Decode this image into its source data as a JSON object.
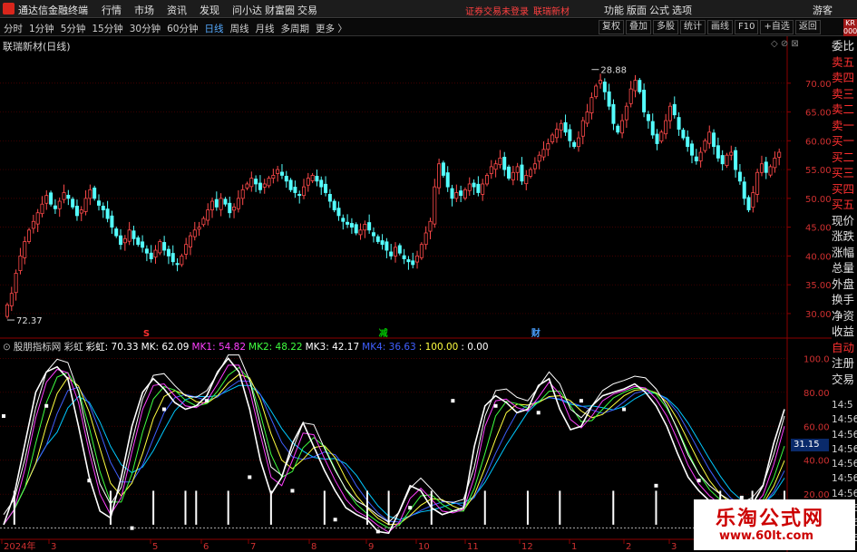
{
  "app": {
    "title": "通达信金融终端",
    "login_status": "证券交易未登录",
    "stock_tag": "联瑞新材",
    "guest": "游客"
  },
  "main_menu": [
    "行情",
    "市场",
    "资讯",
    "发现",
    "问小达",
    "财富圈",
    "交易"
  ],
  "right_menu": [
    "功能",
    "版面",
    "公式",
    "选项"
  ],
  "periods": [
    {
      "label": "分时",
      "active": false
    },
    {
      "label": "1分钟",
      "active": false
    },
    {
      "label": "5分钟",
      "active": false
    },
    {
      "label": "15分钟",
      "active": false
    },
    {
      "label": "30分钟",
      "active": false
    },
    {
      "label": "60分钟",
      "active": false
    },
    {
      "label": "日线",
      "active": true
    },
    {
      "label": "周线",
      "active": false
    },
    {
      "label": "月线",
      "active": false
    },
    {
      "label": "多周期",
      "active": false
    },
    {
      "label": "更多 〉",
      "active": false
    }
  ],
  "toolbar_buttons": [
    "复权",
    "叠加",
    "多股",
    "统计",
    "画线",
    "F10",
    "+自选",
    "返回"
  ],
  "side_tag": "KR\n000",
  "side_panel": [
    {
      "label": "委比",
      "red": false
    },
    {
      "label": "卖五",
      "red": true
    },
    {
      "label": "卖四",
      "red": true
    },
    {
      "label": "卖三",
      "red": true
    },
    {
      "label": "卖二",
      "red": true
    },
    {
      "label": "卖一",
      "red": true
    },
    {
      "label": "买一",
      "red": true
    },
    {
      "label": "买二",
      "red": true
    },
    {
      "label": "买三",
      "red": true
    },
    {
      "label": "买四",
      "red": true
    },
    {
      "label": "买五",
      "red": true
    },
    {
      "label": "现价",
      "red": false
    },
    {
      "label": "涨跌",
      "red": false
    },
    {
      "label": "涨幅",
      "red": false
    },
    {
      "label": "总量",
      "red": false
    },
    {
      "label": "外盘",
      "red": false
    },
    {
      "label": "换手",
      "red": false
    },
    {
      "label": "净资",
      "red": false
    },
    {
      "label": "收益",
      "red": false
    },
    {
      "label": "自动",
      "red": true
    },
    {
      "label": "注册",
      "red": false
    },
    {
      "label": "交易",
      "red": false
    }
  ],
  "side_times": [
    "14:5",
    "14:56",
    "14:56",
    "14:56",
    "14:56",
    "14:56",
    "14:56",
    "14:56",
    "14:56",
    "14:56"
  ],
  "watermark": {
    "text": "乐淘公式网",
    "url": "www.60lt.com"
  },
  "chart_data": [
    {
      "type": "candlestick",
      "title": "联瑞新材(日线)",
      "ylim": [
        27,
        75
      ],
      "yticks": [
        "70.00",
        "65.00",
        "60.00",
        "55.00",
        "50.00",
        "45.00",
        "40.00",
        "35.00",
        "30.00"
      ],
      "ytick_values": [
        70,
        65,
        60,
        55,
        50,
        45,
        40,
        35,
        30
      ],
      "annotations": [
        {
          "text": "72.37",
          "value": 72.37
        },
        {
          "text": "28.88",
          "value": 28.88
        }
      ],
      "event_markers": [
        {
          "text": "S",
          "index": 32,
          "color": "#ff3030"
        },
        {
          "text": "减",
          "index": 86,
          "color": "#00c000"
        },
        {
          "text": "财",
          "index": 121,
          "color": "#4aa0ff"
        }
      ],
      "closes": [
        31.5,
        33.5,
        37,
        40,
        42.5,
        44.5,
        46,
        47.5,
        49,
        50.5,
        49,
        48.2,
        49.5,
        51,
        50,
        48.5,
        47,
        48,
        50,
        51.5,
        50,
        48.8,
        48,
        46.5,
        45,
        43.5,
        42,
        43,
        44.5,
        43,
        42,
        41.5,
        40.5,
        39.5,
        41,
        42.5,
        41,
        40,
        39,
        38.5,
        40,
        42,
        43.5,
        44.5,
        45,
        46.5,
        48,
        49.5,
        48.5,
        50,
        49,
        47.5,
        48.5,
        50,
        51.5,
        52.5,
        53.5,
        52.5,
        51.5,
        52.5,
        53.5,
        54,
        55,
        54,
        53,
        51.5,
        51,
        50.5,
        52,
        53.5,
        54,
        53,
        52,
        51,
        49.5,
        48,
        47,
        46,
        45.5,
        45,
        44,
        44.5,
        45.5,
        44.5,
        43.5,
        42.5,
        42,
        41,
        40,
        41.5,
        40.5,
        39.5,
        39,
        38.5,
        40,
        42,
        44,
        46,
        52,
        56,
        54,
        52,
        50,
        51,
        50.5,
        51.5,
        52.5,
        52,
        51,
        52.5,
        54,
        55.5,
        56,
        57,
        55,
        53.5,
        54.5,
        55.5,
        53,
        54,
        55,
        56,
        57.5,
        58.5,
        59.5,
        61,
        62,
        63,
        61.5,
        60,
        59,
        60.5,
        63.5,
        65,
        67.5,
        69.5,
        70.5,
        68.5,
        66,
        63,
        61.5,
        63.5,
        66,
        69,
        70.5,
        68.5,
        65,
        63.5,
        61,
        59.5,
        61.5,
        63.5,
        66,
        64.5,
        62,
        60.5,
        59,
        57.5,
        56.5,
        58,
        60,
        61.5,
        59,
        57,
        56,
        57.5,
        58,
        55,
        53,
        50,
        48,
        51,
        54.5,
        56,
        54.5,
        55.5,
        57,
        58
      ],
      "extremes": [
        {
          "index": 0,
          "value": 28.88
        },
        {
          "index": 134,
          "value": 72.37
        }
      ]
    },
    {
      "type": "line",
      "title": "股朋指标网 彩虹",
      "legend": [
        {
          "label": "彩虹: 70.33",
          "color": "#ffffff"
        },
        {
          "label": "MK: 62.09",
          "color": "#ffffff"
        },
        {
          "label": "MK1: 54.82",
          "color": "#ff40ff"
        },
        {
          "label": "MK2: 48.22",
          "color": "#40ff40"
        },
        {
          "label": "MK3: 42.17",
          "color": "#ffffff"
        },
        {
          "label": "MK4: 36.63",
          "color": "#4060ff"
        },
        {
          "label": ": 100.00",
          "color": "#ffff40"
        },
        {
          "label": ": 0.00",
          "color": "#ffffff"
        }
      ],
      "ylim": [
        -5,
        105
      ],
      "yticks": [
        "100.0",
        "80.00",
        "60.00",
        "40.00",
        "20.00"
      ],
      "ytick_values": [
        100,
        80,
        60,
        40,
        20
      ],
      "current_value_label": "31.15",
      "series_colors": [
        "#ffffff",
        "#ff40ff",
        "#40ff40",
        "#ffff40",
        "#4060ff",
        "#00c8ff"
      ],
      "main": [
        2,
        20,
        50,
        80,
        92,
        95,
        88,
        60,
        30,
        10,
        6,
        30,
        60,
        80,
        88,
        82,
        74,
        70,
        72,
        78,
        92,
        100,
        92,
        70,
        40,
        20,
        30,
        50,
        62,
        48,
        34,
        22,
        12,
        8,
        5,
        -2,
        -3,
        10,
        25,
        22,
        12,
        8,
        10,
        12,
        48,
        72,
        78,
        74,
        68,
        70,
        84,
        88,
        70,
        58,
        60,
        72,
        78,
        80,
        82,
        85,
        80,
        72,
        60,
        44,
        30,
        22,
        16,
        12,
        8,
        10,
        14,
        25,
        50,
        70
      ],
      "markers": [
        66,
        72,
        28,
        0,
        70,
        75,
        30,
        22,
        5,
        -2,
        12,
        75,
        72,
        68,
        75,
        70,
        25,
        28,
        18,
        12
      ],
      "white_bar_indices": [
        1,
        10,
        14,
        17,
        19,
        22,
        26,
        31,
        35,
        37,
        41,
        46,
        50,
        53,
        59,
        63,
        69,
        72,
        75
      ]
    }
  ],
  "xaxis_labels": [
    "2024年",
    "3",
    "2024年",
    "5",
    "6",
    "7",
    "8",
    "9",
    "10",
    "11",
    "12",
    "1",
    "2",
    "3"
  ]
}
